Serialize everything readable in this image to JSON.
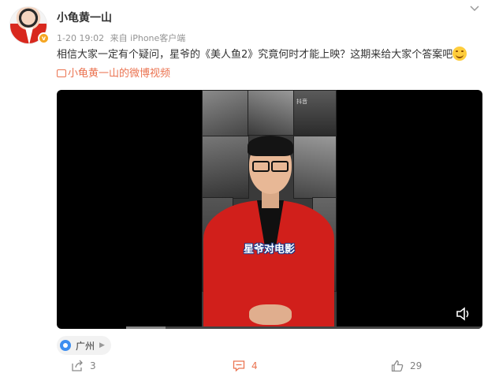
{
  "post": {
    "username": "小龟黄一山",
    "verified_badge": "v",
    "date": "1-20 19:02",
    "source": "来自 iPhone客户端",
    "text": "相信大家一定有个疑问，星爷的《美人鱼2》究竟何时才能上映？这期来给大家个答案吧",
    "video_link_label": "小龟黄一山的微博视频"
  },
  "video": {
    "watermark": "抖音",
    "subtitle": "星爷对电影",
    "progress_fraction": 0.11
  },
  "location": {
    "label": "广州"
  },
  "actions": {
    "share_count": "3",
    "comment_count": "4",
    "like_count": "29"
  },
  "colors": {
    "accent": "#eb7350",
    "jacket": "#d11f1b",
    "badge": "#f5a623"
  }
}
